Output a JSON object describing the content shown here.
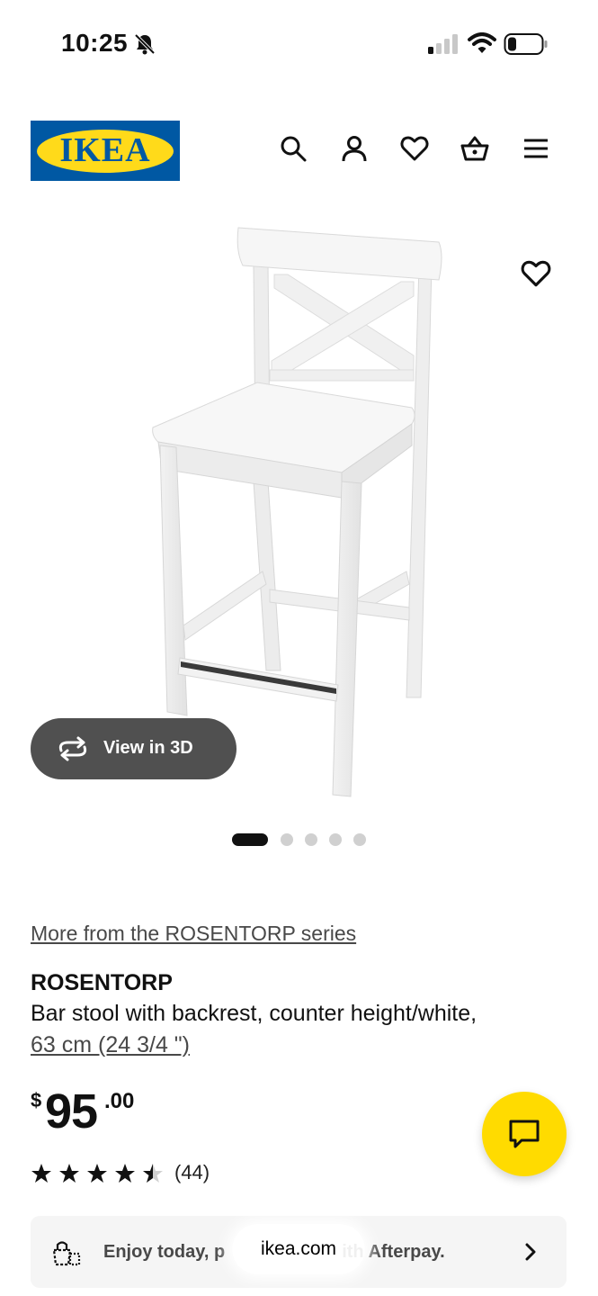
{
  "status_bar": {
    "time": "10:25",
    "icons": [
      "bell-slash-icon",
      "signal-icon",
      "wifi-icon",
      "battery-icon"
    ]
  },
  "header": {
    "logo_text": "IKEA",
    "icons": [
      "search-icon",
      "account-icon",
      "heart-icon",
      "basket-icon",
      "menu-icon"
    ],
    "colors": {
      "logo_blue": "#0058a3",
      "logo_yellow": "#ffda1a"
    }
  },
  "gallery": {
    "view_3d_label": "View in 3D",
    "slide_count": 5,
    "active_slide": 1
  },
  "product": {
    "series_link": "More from the ROSENTORP series",
    "name": "ROSENTORP",
    "description": "Bar stool with backrest, counter height/white,",
    "size_link": "63 cm (24 3/4 \")",
    "price": {
      "currency": "$",
      "integer": "95",
      "decimal": ".00"
    },
    "rating": 4.5,
    "review_count": "(44)"
  },
  "chat": {
    "icon": "chat-icon",
    "color": "#ffdb00"
  },
  "afterpay": {
    "text_left": "Enjoy today, p",
    "text_right": "ith Afterpay."
  },
  "browser": {
    "url": "ikea.com"
  }
}
